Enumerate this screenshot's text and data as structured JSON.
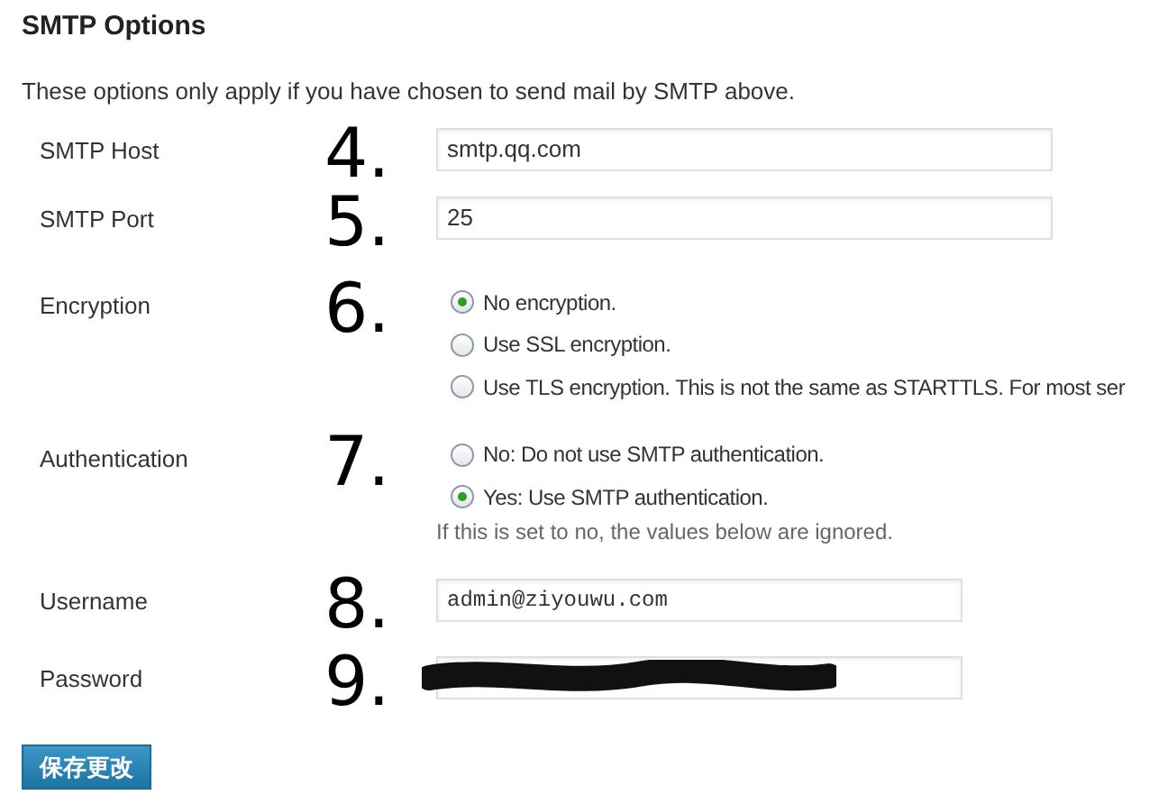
{
  "heading": "SMTP Options",
  "description": "These options only apply if you have chosen to send mail by SMTP above.",
  "rows": [
    {
      "kind": "text",
      "label": "SMTP Host",
      "annotation": "4.",
      "value": "smtp.qq.com",
      "mono": false
    },
    {
      "kind": "text",
      "label": "SMTP Port",
      "annotation": "5.",
      "value": "25",
      "mono": false
    },
    {
      "kind": "radios",
      "label": "Encryption",
      "annotation": "6.",
      "options": [
        {
          "text": "No encryption.",
          "selected": true
        },
        {
          "text": "Use SSL encryption.",
          "selected": false
        },
        {
          "text": "Use TLS encryption. This is not the same as STARTTLS. For most ser",
          "selected": false
        }
      ]
    },
    {
      "kind": "radios",
      "label": "Authentication",
      "annotation": "7.",
      "options": [
        {
          "text": "No: Do not use SMTP authentication.",
          "selected": false
        },
        {
          "text": "Yes: Use SMTP authentication.",
          "selected": true
        }
      ],
      "hint": "If this is set to no, the values below are ignored."
    },
    {
      "kind": "text",
      "label": "Username",
      "annotation": "8.",
      "value": "admin@ziyouwu.com",
      "mono": true
    },
    {
      "kind": "redacted",
      "label": "Password",
      "annotation": "9."
    }
  ],
  "save_button": "保存更改"
}
